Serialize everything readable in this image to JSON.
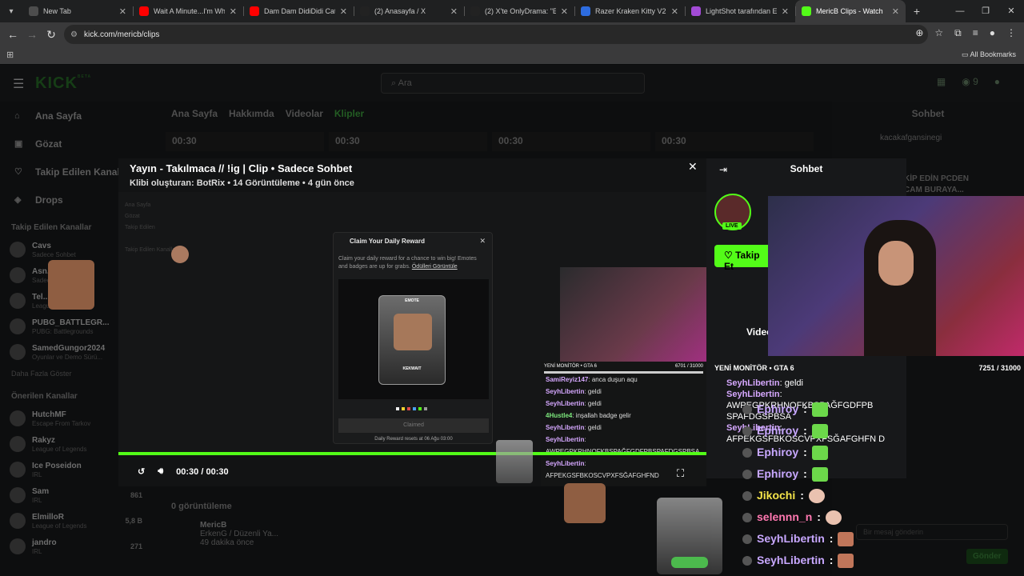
{
  "browser": {
    "tabs": [
      {
        "title": "New Tab",
        "color": "#4d4d4d"
      },
      {
        "title": "Wait A Minute...I'm White",
        "color": "#ff0000"
      },
      {
        "title": "Dam Dam DidiDidi Cat - (",
        "color": "#ff0000"
      },
      {
        "title": "(2) Anasayfa / X",
        "color": "#222222"
      },
      {
        "title": "(2) X'te OnlyDrama: \"Eldo",
        "color": "#222222"
      },
      {
        "title": "Razer Kraken Kitty V2 RZ0",
        "color": "#2d6cdf"
      },
      {
        "title": "LightShot tarafından Ekra",
        "color": "#a34bd6"
      },
      {
        "title": "MericB Clips - Watch",
        "color": "#53fc18"
      }
    ],
    "url": "kick.com/mericb/clips",
    "all_bookmarks": "All Bookmarks"
  },
  "kick": {
    "logo": "KICK",
    "logo_beta": "BETA",
    "search_placeholder": "Ara",
    "notif_count": "9",
    "nav": [
      {
        "label": "Ana Sayfa",
        "icon": "home-icon",
        "glyph": "⌂"
      },
      {
        "label": "Gözat",
        "icon": "compass-icon",
        "glyph": "▣"
      },
      {
        "label": "Takip Edilen Kanallar",
        "icon": "heart-icon",
        "glyph": "♡"
      },
      {
        "label": "Drops",
        "icon": "drop-icon",
        "glyph": "◈"
      }
    ],
    "followed_head": "Takip Edilen Kanallar",
    "followed": [
      {
        "name": "Cavs",
        "game": "Sadece Sohbet",
        "count": ""
      },
      {
        "name": "Asn...",
        "game": "Sadece Sohbet",
        "count": ""
      },
      {
        "name": "Tel...",
        "game": "League of Legends",
        "count": ""
      },
      {
        "name": "PUBG_BATTLEGR...",
        "game": "PUBG: Battlegrounds",
        "count": ""
      },
      {
        "name": "SamedGungor2024",
        "game": "Oyunlar ve Demo Sürü...",
        "count": ""
      }
    ],
    "more": "Daha Fazla Göster",
    "recommended_head": "Önerilen Kanallar",
    "recommended": [
      {
        "name": "HutchMF",
        "game": "Escape From Tarkov",
        "count": ""
      },
      {
        "name": "Rakyz",
        "game": "League of Legends",
        "count": ""
      },
      {
        "name": "Ice Poseidon",
        "game": "IRL",
        "count": ""
      },
      {
        "name": "Sam",
        "game": "IRL",
        "count": "861"
      },
      {
        "name": "ElmilloR",
        "game": "League of Legends",
        "count": "5,8 B"
      },
      {
        "name": "jandro",
        "game": "IRL",
        "count": "271"
      }
    ],
    "subtabs": [
      "Ana Sayfa",
      "Hakkımda",
      "Videolar",
      "Klipler"
    ],
    "thumb_times": [
      "00:30",
      "00:30",
      "00:30",
      "00:30"
    ],
    "right_head": "Sohbet",
    "pinned_user": "kacakafgansinegi",
    "pinned_msg": "KİP EDİN PCDEN\nCAM BURAYA...",
    "views_label": "0 görüntüleme",
    "clip_channel": "MericB",
    "clip_title": "ErkenG / Düzenli Ya...",
    "clip_time": "49 dakika önce",
    "send_placeholder": "Bir mesaj gönderin",
    "send_button": "Gönder"
  },
  "clip": {
    "title": "Yayın - Takılmaca // !ig | Clip • Sadece Sohbet",
    "subtitle": "Klibi oluşturan: BotRix • 14 Görüntüleme • 4 gün önce",
    "time": "00:30 / 00:30",
    "progress": 1.0,
    "reward": {
      "title": "Claim Your Daily Reward",
      "desc": "Claim your daily reward for a chance to win big! Emotes and badges are up for grabs.",
      "link": "Ödülleri Görüntüle",
      "emote_tag": "EMOTE",
      "emote_name": "KEKWAIT",
      "claimed": "Claimed",
      "reset": "Daily Reward resets at 06 Ağu 03:00"
    },
    "inner_goal": "YENİ MONİTÖR • GTA 6",
    "inner_goal_count": "6701 / 31000",
    "inner_chat": [
      {
        "user": "SamiReyiz147",
        "text": ": anca duşun aqu"
      },
      {
        "user": "SeyhLibertin",
        "text": ": geldi"
      },
      {
        "user": "SeyhLibertin",
        "text": ": geldi"
      },
      {
        "user": "4Hustle4",
        "text": ": inşallah badge gelir"
      },
      {
        "user": "SeyhLibertin",
        "text": ": geldi"
      },
      {
        "user": "SeyhLibertin",
        "text": ":"
      },
      {
        "user": "",
        "text": "AWPEGPKRHNOFKBSPAĞFGDFPBSPAFDGSPBSA"
      },
      {
        "user": "SeyhLibertin",
        "text": ":"
      },
      {
        "user": "",
        "text": "AFPEKGSFBKOSCVPXFSĞAFGHFND"
      }
    ]
  },
  "chatpanel": {
    "title": "Sohbet",
    "live": "LIVE",
    "follow": "Takip Et",
    "videos": "Video",
    "goal": "YENİ MONİTÖR • GTA 6",
    "goal_count": "7251 / 31000",
    "msgs": [
      {
        "user": "SeyhLibertin",
        "text": ": geldi"
      },
      {
        "user": "SeyhLibertin",
        "text": ":"
      },
      {
        "user": "",
        "text": "AWPEGPKRHNOFKBSPAĞFGDFPB SPAFDGSPBSA"
      },
      {
        "user": "SeyhLibertin",
        "text": ":"
      },
      {
        "user": "",
        "text": "AFPEKGSFBKOSCVPXFSĞAFGHFN D"
      }
    ],
    "stack": [
      {
        "user": "Ephiroy",
        "color": "#c8a8ff",
        "emote": "em"
      },
      {
        "user": "Ephiroy",
        "color": "#c8a8ff",
        "emote": "em"
      },
      {
        "user": "Ephiroy",
        "color": "#c8a8ff",
        "emote": "em"
      },
      {
        "user": "Ephiroy",
        "color": "#c8a8ff",
        "emote": "em"
      },
      {
        "user": "Jikochi",
        "color": "#f4e44a",
        "emote": "em3"
      },
      {
        "user": "selennn_n",
        "color": "#ff78b0",
        "emote": "em3"
      },
      {
        "user": "SeyhLibertin",
        "color": "#c8a8ff",
        "emote": "em2"
      },
      {
        "user": "SeyhLibertin",
        "color": "#c8a8ff",
        "emote": "em2"
      }
    ]
  }
}
